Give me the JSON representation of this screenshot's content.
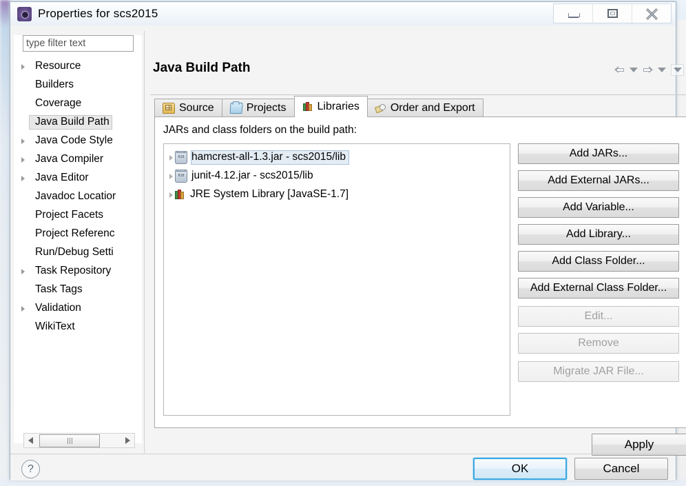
{
  "window": {
    "title": "Properties for scs2015",
    "icon": "eclipse-properties-icon",
    "controls": {
      "minimize": "Minimize",
      "maximize": "Maximize",
      "close": "Close"
    }
  },
  "sidebar": {
    "filter": {
      "placeholder": "type filter text",
      "value": ""
    },
    "items": [
      {
        "label": "Resource",
        "expandable": true,
        "selected": false
      },
      {
        "label": "Builders",
        "expandable": false,
        "selected": false
      },
      {
        "label": "Coverage",
        "expandable": false,
        "selected": false
      },
      {
        "label": "Java Build Path",
        "expandable": false,
        "selected": true
      },
      {
        "label": "Java Code Style",
        "expandable": true,
        "selected": false
      },
      {
        "label": "Java Compiler",
        "expandable": true,
        "selected": false
      },
      {
        "label": "Java Editor",
        "expandable": true,
        "selected": false
      },
      {
        "label": "Javadoc Locatior",
        "expandable": false,
        "selected": false
      },
      {
        "label": "Project Facets",
        "expandable": false,
        "selected": false
      },
      {
        "label": "Project Referenc",
        "expandable": false,
        "selected": false
      },
      {
        "label": "Run/Debug Setti",
        "expandable": false,
        "selected": false
      },
      {
        "label": "Task Repository",
        "expandable": true,
        "selected": false
      },
      {
        "label": "Task Tags",
        "expandable": false,
        "selected": false
      },
      {
        "label": "Validation",
        "expandable": true,
        "selected": false
      },
      {
        "label": "WikiText",
        "expandable": false,
        "selected": false
      }
    ],
    "scrollbar": {
      "left_arrow": "scroll-left",
      "right_arrow": "scroll-right"
    }
  },
  "content": {
    "page_title": "Java Build Path",
    "nav": {
      "back": "back-arrow",
      "back_menu": "back-dropdown",
      "forward": "forward-arrow",
      "forward_menu": "forward-dropdown",
      "view_menu": "view-menu-dropdown"
    },
    "tabs": [
      {
        "label": "Source",
        "icon": "source-folder-icon",
        "active": false
      },
      {
        "label": "Projects",
        "icon": "projects-folder-icon",
        "active": false
      },
      {
        "label": "Libraries",
        "icon": "libraries-books-icon",
        "active": true
      },
      {
        "label": "Order and Export",
        "icon": "order-export-icon",
        "active": false
      }
    ],
    "panel_label": "JARs and class folders on the build path:",
    "libraries": [
      {
        "label": "hamcrest-all-1.3.jar - scs2015/lib",
        "icon": "jar-icon",
        "selected": true
      },
      {
        "label": "junit-4.12.jar - scs2015/lib",
        "icon": "jar-icon",
        "selected": false
      },
      {
        "label": "JRE System Library [JavaSE-1.7]",
        "icon": "jre-library-icon",
        "selected": false
      }
    ],
    "side_buttons": [
      {
        "label": "Add JARs...",
        "enabled": true
      },
      {
        "label": "Add External JARs...",
        "enabled": true
      },
      {
        "label": "Add Variable...",
        "enabled": true
      },
      {
        "label": "Add Library...",
        "enabled": true
      },
      {
        "label": "Add Class Folder...",
        "enabled": true
      },
      {
        "label": "Add External Class Folder...",
        "enabled": true
      },
      {
        "label": "Edit...",
        "enabled": false
      },
      {
        "label": "Remove",
        "enabled": false
      },
      {
        "label": "Migrate JAR File...",
        "enabled": false
      }
    ],
    "apply_label": "Apply"
  },
  "footer": {
    "help": "?",
    "ok_label": "OK",
    "cancel_label": "Cancel"
  },
  "colors": {
    "accent_focus": "#3ca8e0",
    "selection_sidebar": "#e8e8e8",
    "selection_list": "#e4ecf4",
    "dialog_bg": "#f4f4f4"
  }
}
